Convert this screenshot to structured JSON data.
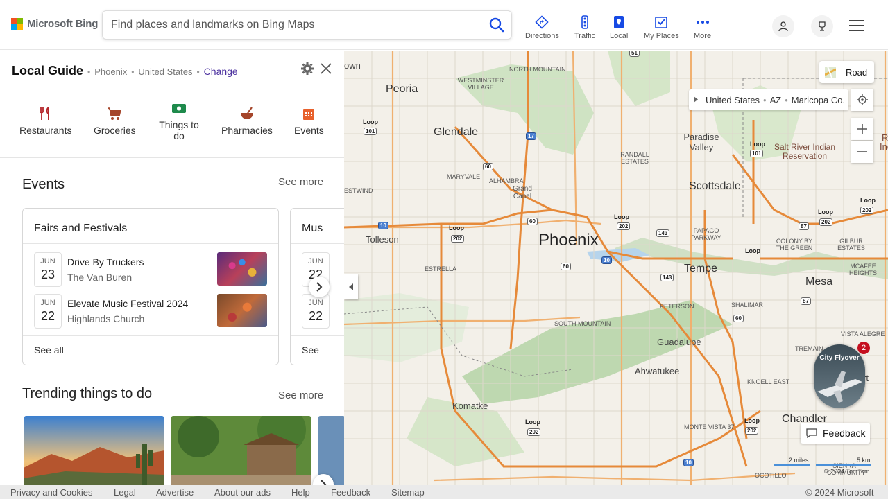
{
  "brand": {
    "name": "Microsoft Bing"
  },
  "search": {
    "placeholder": "Find places and landmarks on Bing Maps"
  },
  "nav": {
    "directions": "Directions",
    "traffic": "Traffic",
    "local": "Local",
    "my_places": "My Places",
    "more": "More"
  },
  "panel": {
    "title": "Local Guide",
    "city": "Phoenix",
    "country": "United States",
    "change": "Change",
    "categories": [
      "Restaurants",
      "Groceries",
      "Things to do",
      "Pharmacies",
      "Events"
    ],
    "events_title": "Events",
    "see_more": "See more",
    "card1": {
      "title": "Fairs and Festivals",
      "events": [
        {
          "month": "JUN",
          "day": "23",
          "name": "Drive By Truckers",
          "venue": "The Van Buren"
        },
        {
          "month": "JUN",
          "day": "22",
          "name": "Elevate Music Festival 2024",
          "venue": "Highlands Church"
        }
      ],
      "see_all": "See all"
    },
    "card2": {
      "title": "Mus",
      "events": [
        {
          "month": "JUN",
          "day": "22"
        },
        {
          "month": "JUN",
          "day": "22"
        }
      ],
      "see_all": "See"
    },
    "trending_title": "Trending things to do",
    "trending_see_more": "See more"
  },
  "map": {
    "road": "Road",
    "breadcrumb": [
      "United States",
      "AZ",
      "Maricopa Co."
    ],
    "flyover": "City Flyover",
    "flyover_badge": "2",
    "feedback": "Feedback",
    "scale_miles": "2 miles",
    "scale_km": "5 km",
    "copyright": "© 2024 TomTom",
    "labels": {
      "phoenix": "Phoenix",
      "glendale": "Glendale",
      "peoria": "Peoria",
      "scottsdale": "Scottsdale",
      "tempe": "Tempe",
      "mesa": "Mesa",
      "tolleson": "Tolleson",
      "guadalupe": "Guadalupe",
      "ahwatukee": "Ahwatukee",
      "komatke": "Komatke",
      "chandler": "Chandler",
      "paradise_valley": "Paradise Valley",
      "salt_river": "Salt River Indian Reservation",
      "grand_canal": "Grand Canal",
      "own": "own",
      "north_mountain": "NORTH MOUNTAIN",
      "westminster": "WESTMINSTER VILLAGE",
      "maryvale": "MARYVALE",
      "alhambra": "ALHAMBRA",
      "randall": "RANDALL ESTATES",
      "papago": "PAPAGO PARKWAY",
      "colony": "COLONY BY THE GREEN",
      "gilbur": "GILBUR ESTATES",
      "estrella": "ESTRELLA",
      "peterson": "PETERSON",
      "south_mountain": "SOUTH MOUNTAIN",
      "shalimar": "SHALIMAR",
      "mcafee": "MCAFEE HEIGHTS",
      "vista": "VISTA ALEGRE",
      "knoell": "KNOELL EAST",
      "monte": "MONTE VISTA 37",
      "ocotillo": "OCOTILLO",
      "westwind": "ESTWIND",
      "treman": "TREMAIN",
      "sienna": "SIENNA COMMUNITY",
      "rt": "rt",
      "riv": "Riv",
      "indi": "Indi"
    },
    "shields": [
      "51",
      "101",
      "17",
      "60",
      "60",
      "60",
      "10",
      "202",
      "202",
      "143",
      "143",
      "10",
      "101",
      "87",
      "87",
      "202",
      "202",
      "60",
      "202",
      "10",
      "202"
    ],
    "loop": "Loop"
  },
  "footer": {
    "privacy": "Privacy and Cookies",
    "legal": "Legal",
    "advertise": "Advertise",
    "about_ads": "About our ads",
    "help": "Help",
    "feedback": "Feedback",
    "sitemap": "Sitemap",
    "copyright": "© 2024 Microsoft"
  }
}
